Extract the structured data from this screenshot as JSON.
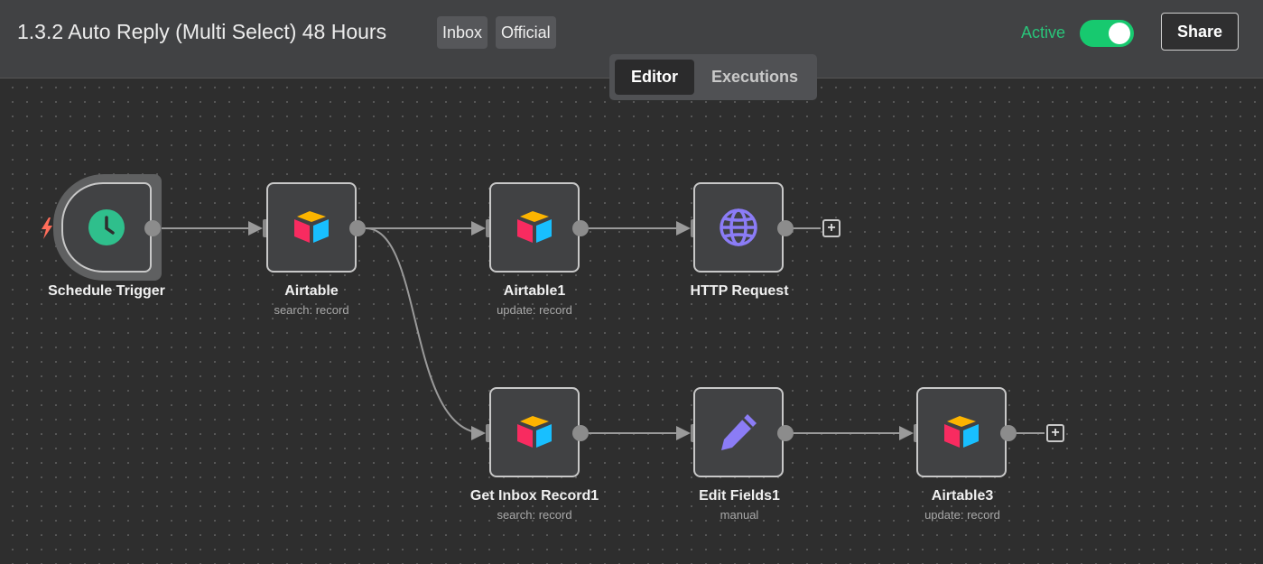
{
  "header": {
    "title": "1.3.2 Auto Reply (Multi Select) 48 Hours",
    "tags": [
      "Inbox",
      "Official"
    ],
    "active_label": "Active",
    "active": true,
    "share_label": "Share"
  },
  "tabs": [
    {
      "label": "Editor",
      "selected": true
    },
    {
      "label": "Executions",
      "selected": false
    }
  ],
  "nodes": {
    "schedule_trigger": {
      "name": "Schedule Trigger",
      "subtitle": "",
      "icon": "clock-icon"
    },
    "airtable": {
      "name": "Airtable",
      "subtitle": "search: record",
      "icon": "airtable-icon"
    },
    "airtable1": {
      "name": "Airtable1",
      "subtitle": "update: record",
      "icon": "airtable-icon"
    },
    "http_request": {
      "name": "HTTP Request",
      "subtitle": "",
      "icon": "globe-icon"
    },
    "get_inbox_record1": {
      "name": "Get Inbox Record1",
      "subtitle": "search: record",
      "icon": "airtable-icon"
    },
    "edit_fields1": {
      "name": "Edit Fields1",
      "subtitle": "manual",
      "icon": "pencil-icon"
    },
    "airtable3": {
      "name": "Airtable3",
      "subtitle": "update: record",
      "icon": "airtable-icon"
    }
  },
  "connections": [
    [
      "Schedule Trigger",
      "Airtable"
    ],
    [
      "Airtable",
      "Airtable1"
    ],
    [
      "Airtable",
      "Get Inbox Record1"
    ],
    [
      "Airtable1",
      "HTTP Request"
    ],
    [
      "Get Inbox Record1",
      "Edit Fields1"
    ],
    [
      "Edit Fields1",
      "Airtable3"
    ]
  ],
  "add_buttons": {
    "symbol": "+"
  },
  "colors": {
    "active_green": "#17c96f",
    "trigger_bolt": "#ff6d5a",
    "clock": "#2fbf8c",
    "globe": "#8b7cf6",
    "pencil": "#8b7cf6",
    "airtable_yellow": "#fcb400",
    "airtable_blue": "#18bfff",
    "airtable_red": "#f82b60"
  }
}
